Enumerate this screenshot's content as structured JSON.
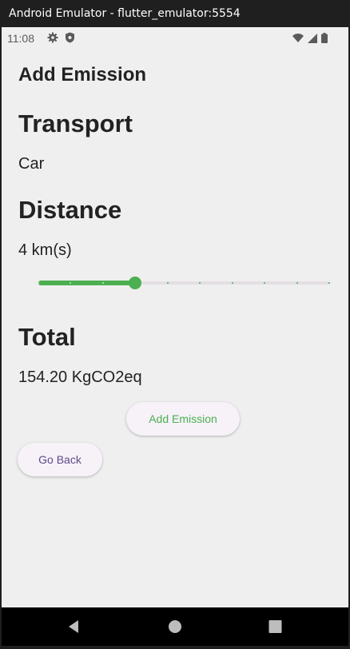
{
  "window": {
    "title": "Android Emulator - flutter_emulator:5554"
  },
  "status_bar": {
    "time": "11:08",
    "left_icons": [
      "gear-icon",
      "shield-icon"
    ],
    "right_icons": [
      "wifi-icon",
      "signal-icon",
      "battery-icon"
    ]
  },
  "app_bar": {
    "title": "Add Emission"
  },
  "transport": {
    "heading": "Transport",
    "value": "Car"
  },
  "distance": {
    "heading": "Distance",
    "value_label": "4 km(s)",
    "slider": {
      "min": 1,
      "max": 10,
      "value": 4,
      "divisions": 9
    }
  },
  "total": {
    "heading": "Total",
    "value": "154.20 KgCO2eq"
  },
  "buttons": {
    "add_emission": "Add Emission",
    "go_back": "Go Back"
  },
  "colors": {
    "accent_green": "#4caf50",
    "purple_text": "#5f4b8b",
    "background": "#efefef"
  },
  "nav_bar": {
    "items": [
      "back-icon",
      "home-icon",
      "recents-icon"
    ]
  }
}
